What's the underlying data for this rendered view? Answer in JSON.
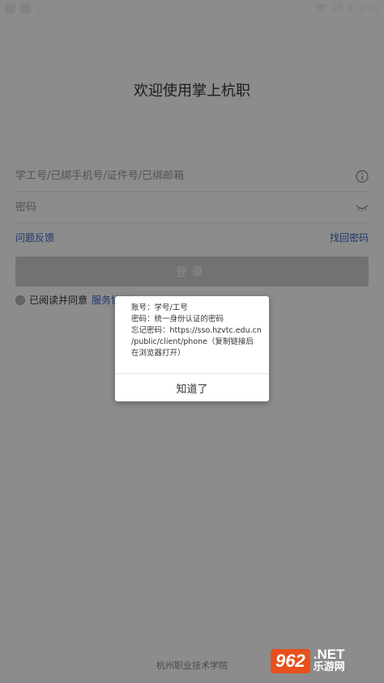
{
  "status_bar": {
    "time": "9:25"
  },
  "login": {
    "welcome_title": "欢迎使用掌上杭职",
    "account_placeholder": "学工号/已绑手机号/证件号/已绑邮箱",
    "password_placeholder": "密码",
    "feedback_link": "问题反馈",
    "recover_password_link": "找回密码",
    "login_button": "登录",
    "agree_prefix": "已阅读并同意",
    "agreement_link": "服务协议"
  },
  "footer": {
    "school_name": "杭州职业技术学院"
  },
  "dialog": {
    "lines": [
      "账号：学号/工号",
      "密码：统一身份认证的密码",
      "忘记密码：https://sso.hzvtc.edu.cn",
      "/public/client/phone（复制链接后",
      "在浏览器打开）"
    ],
    "confirm_button": "知道了"
  },
  "watermark": {
    "logo": "962",
    "net": ".NET",
    "cn": "乐游网"
  }
}
